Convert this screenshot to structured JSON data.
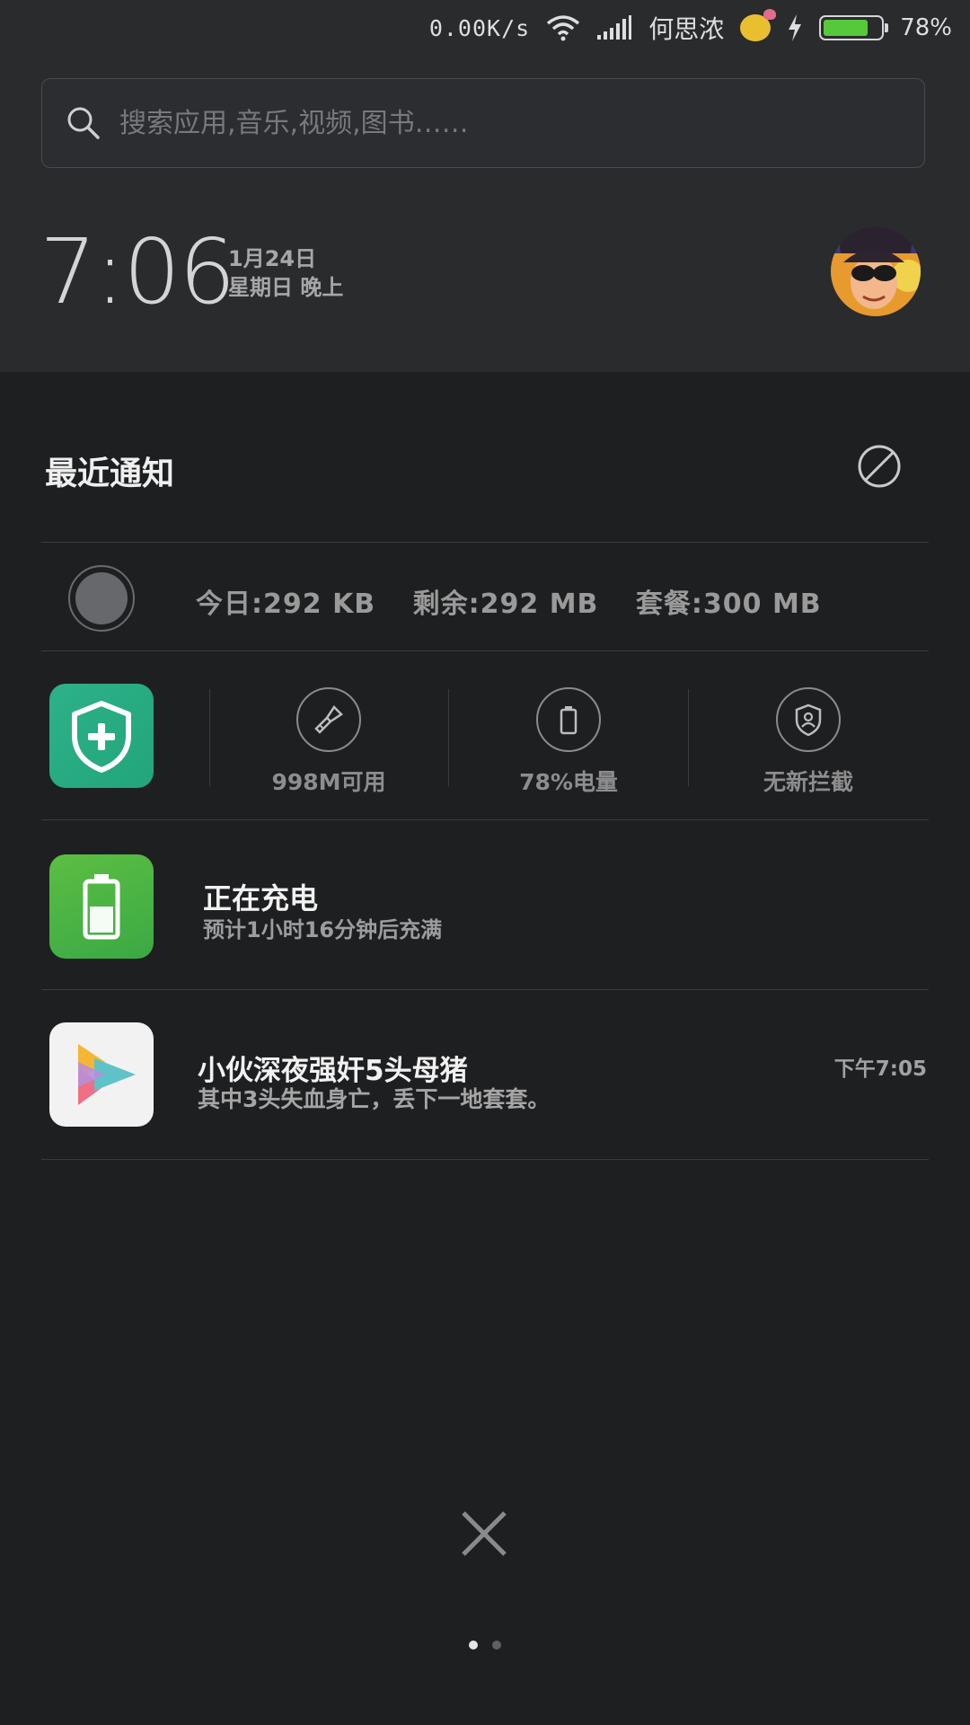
{
  "status_bar": {
    "network_speed": "0.00K/s",
    "carrier": "何思浓",
    "battery_percent": "78%",
    "battery_level": 0.78
  },
  "search": {
    "placeholder": "搜索应用,音乐,视频,图书……"
  },
  "clock": {
    "time": "7:06",
    "date": "1月24日",
    "weekday_period": "星期日 晚上"
  },
  "notifications": {
    "header": "最近通知",
    "data_usage": {
      "today": "今日:292 KB",
      "remaining": "剩余:292 MB",
      "plan": "套餐:300 MB"
    },
    "security": {
      "items": [
        {
          "icon": "broom-icon",
          "label": "998M可用"
        },
        {
          "icon": "battery-icon",
          "label": "78%电量"
        },
        {
          "icon": "shield-user-icon",
          "label": "无新拦截"
        }
      ]
    },
    "charging": {
      "title": "正在充电",
      "subtitle": "预计1小时16分钟后充满"
    },
    "news": {
      "title": "小伙深夜强奸5头母猪",
      "subtitle": "其中3头失血身亡，丢下一地套套。",
      "time": "下午7:05"
    }
  },
  "pager": {
    "pages": 2,
    "active": 0
  },
  "colors": {
    "top_bg": "#2a2b2d",
    "body_bg": "#1e1f21",
    "security_green": "#2db188",
    "battery_green": "#56c93a"
  }
}
